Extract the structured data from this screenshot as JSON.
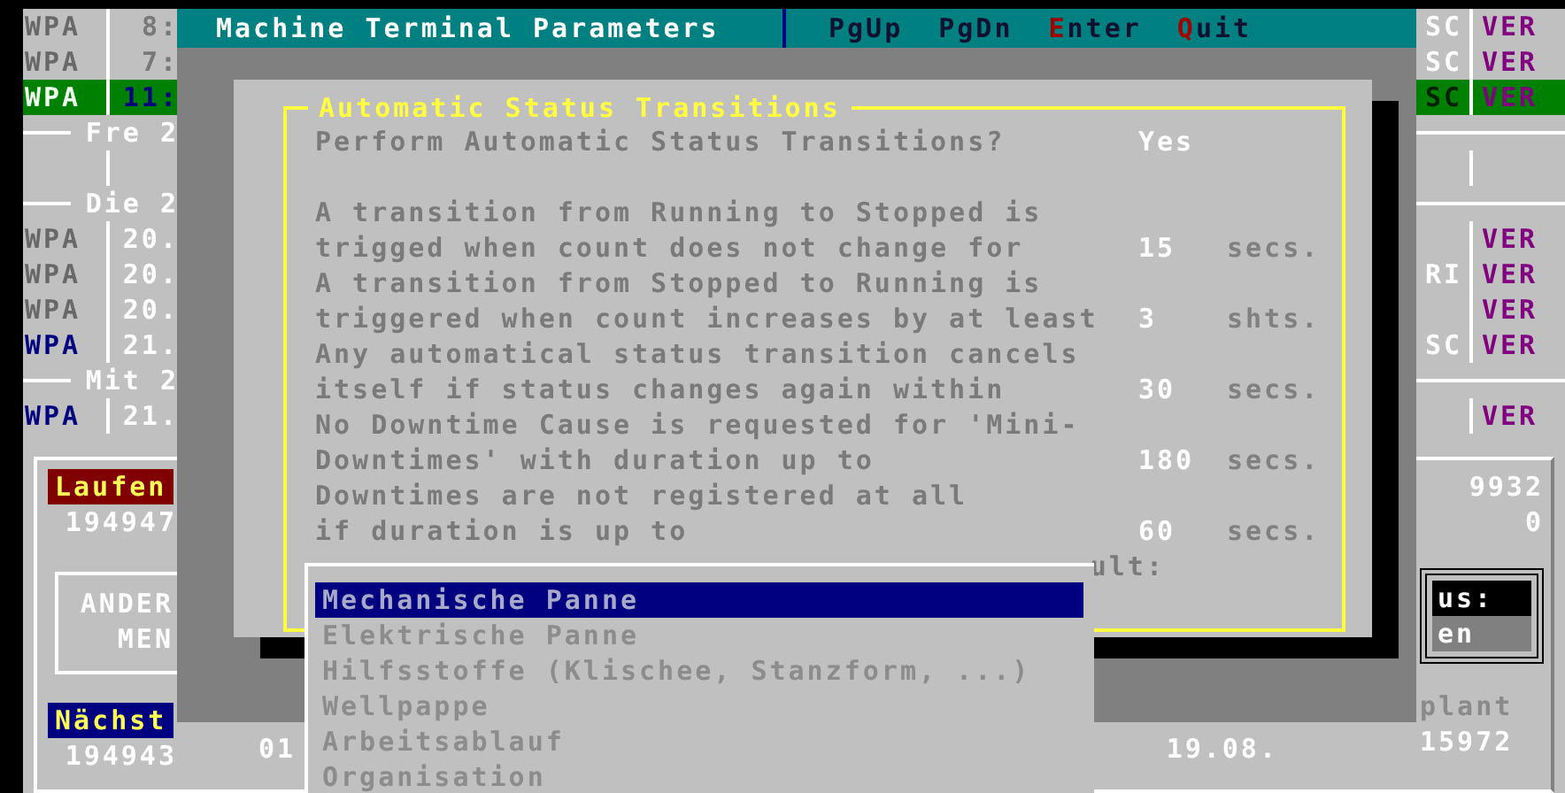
{
  "background": {
    "rows": [
      {
        "kind": "entry",
        "wpa": "WPA",
        "time": "8:",
        "code": "SC",
        "ver": "VER",
        "blue": false,
        "time_dim": true,
        "selected": false
      },
      {
        "kind": "entry",
        "wpa": "WPA",
        "time": "7:",
        "code": "SC",
        "ver": "VER",
        "blue": false,
        "time_dim": true,
        "selected": false
      },
      {
        "kind": "entry",
        "wpa": "WPA",
        "time": "11:",
        "code": "SC",
        "ver": "VER",
        "blue": false,
        "selected": true
      },
      {
        "kind": "separator",
        "label": "Fre 2"
      },
      {
        "kind": "blank"
      },
      {
        "kind": "separator",
        "label": "Die 2"
      },
      {
        "kind": "entry",
        "wpa": "WPA",
        "time": "20.",
        "ver": "VER",
        "blue": false,
        "time_dim": false,
        "selected": false
      },
      {
        "kind": "entry",
        "wpa": "WPA",
        "time": "20.",
        "code": "RI",
        "ver": "VER",
        "blue": false,
        "time_dim": false,
        "selected": false
      },
      {
        "kind": "entry",
        "wpa": "WPA",
        "time": "20.",
        "ver": "VER",
        "blue": false,
        "time_dim": false,
        "selected": false
      },
      {
        "kind": "entry",
        "wpa": "WPA",
        "time": "21.",
        "code": "SC",
        "ver": "VER",
        "blue": true,
        "time_dim": false,
        "selected": false
      },
      {
        "kind": "separator",
        "label": "Mit 2"
      },
      {
        "kind": "entry",
        "wpa": "WPA",
        "time": "21.",
        "ver": "VER",
        "blue": true,
        "time_dim": false,
        "selected": false
      }
    ],
    "lower": {
      "running_label": "Laufen",
      "running_value": "194947",
      "menu_lines": [
        "ANDER",
        "MEN"
      ],
      "next_label": "Nächst",
      "next_value": "194943",
      "next_extra": "01",
      "date": "19.08.",
      "right_values": [
        "9932",
        "0"
      ],
      "status_lines": [
        "us:",
        "en"
      ],
      "plant_label": "plant",
      "plant_value": "15972"
    }
  },
  "dialog": {
    "title": "Machine Terminal Parameters",
    "keys": [
      {
        "label": "PgUp",
        "hotkey": false
      },
      {
        "label": "PgDn",
        "hotkey": false
      },
      {
        "label": "Enter",
        "hotkey": true
      },
      {
        "label": "Quit",
        "hotkey": true
      }
    ],
    "section_title": "Automatic Status Transitions",
    "settings": [
      {
        "kind": "question",
        "lines": [
          "Perform Automatic Status Transitions?"
        ],
        "value": "Yes"
      },
      {
        "kind": "threshold",
        "lines": [
          "A transition from Running to Stopped is",
          "trigged when count does not change for"
        ],
        "value": "15",
        "unit": "secs."
      },
      {
        "kind": "threshold",
        "lines": [
          "A transition from Stopped to Running is",
          "triggered when count increases by at least"
        ],
        "value": "3",
        "unit": "shts."
      },
      {
        "kind": "threshold",
        "lines": [
          "Any automatical status transition cancels",
          "itself if status changes again within"
        ],
        "value": "30",
        "unit": "secs."
      },
      {
        "kind": "threshold",
        "lines": [
          "No Downtime Cause is requested for 'Mini-",
          "Downtimes' with duration up to"
        ],
        "value": "180",
        "unit": "secs."
      },
      {
        "kind": "threshold",
        "lines": [
          "Downtimes are not registered at all",
          "if duration is up to"
        ],
        "value": "60",
        "unit": "secs."
      }
    ],
    "cut_line": "ult:"
  },
  "popup": {
    "items": [
      {
        "label": "Mechanische Panne",
        "selected": true
      },
      {
        "label": "Elektrische Panne",
        "selected": false
      },
      {
        "label": "Hilfsstoffe (Klischee, Stanzform, ...)",
        "selected": false
      },
      {
        "label": "Wellpappe",
        "selected": false
      },
      {
        "label": "Arbeitsablauf",
        "selected": false
      },
      {
        "label": "Organisation",
        "selected": false
      }
    ]
  }
}
